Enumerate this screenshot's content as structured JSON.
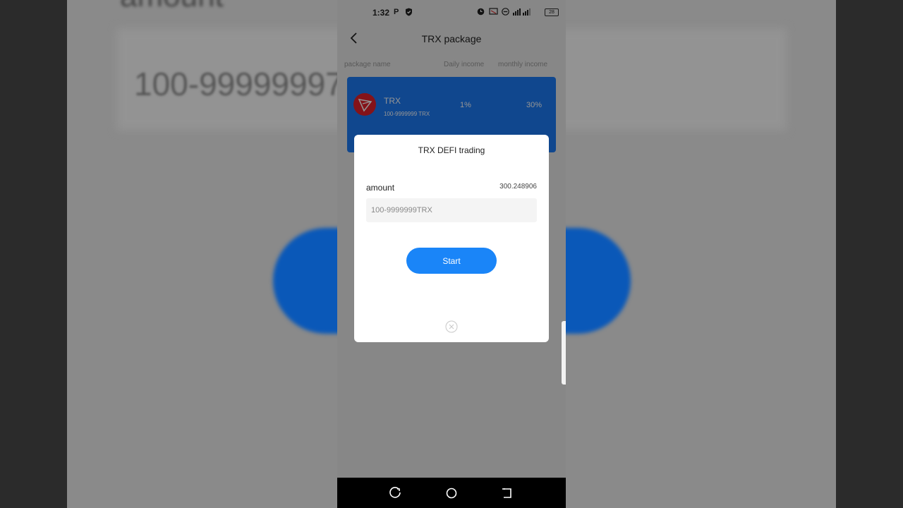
{
  "status_bar": {
    "time": "1:32",
    "battery": "28"
  },
  "header": {
    "title": "TRX package"
  },
  "columns": {
    "package_name": "package name",
    "daily_income": "Daily income",
    "monthly_income": "monthly income"
  },
  "packages": [
    {
      "name": "TRX",
      "range": "100-9999999 TRX",
      "daily": "1%",
      "monthly": "30%"
    }
  ],
  "modal": {
    "title": "TRX DEFI trading",
    "amount_label": "amount",
    "balance": "300.248906",
    "input_placeholder": "100-9999999TRX",
    "input_value": "",
    "start_label": "Start"
  },
  "background": {
    "partial_heading": "amount",
    "amount_text": "100-99999997"
  },
  "colors": {
    "primary": "#1a85f8",
    "card": "#1d7bf5",
    "trx_red": "#e3222c"
  }
}
